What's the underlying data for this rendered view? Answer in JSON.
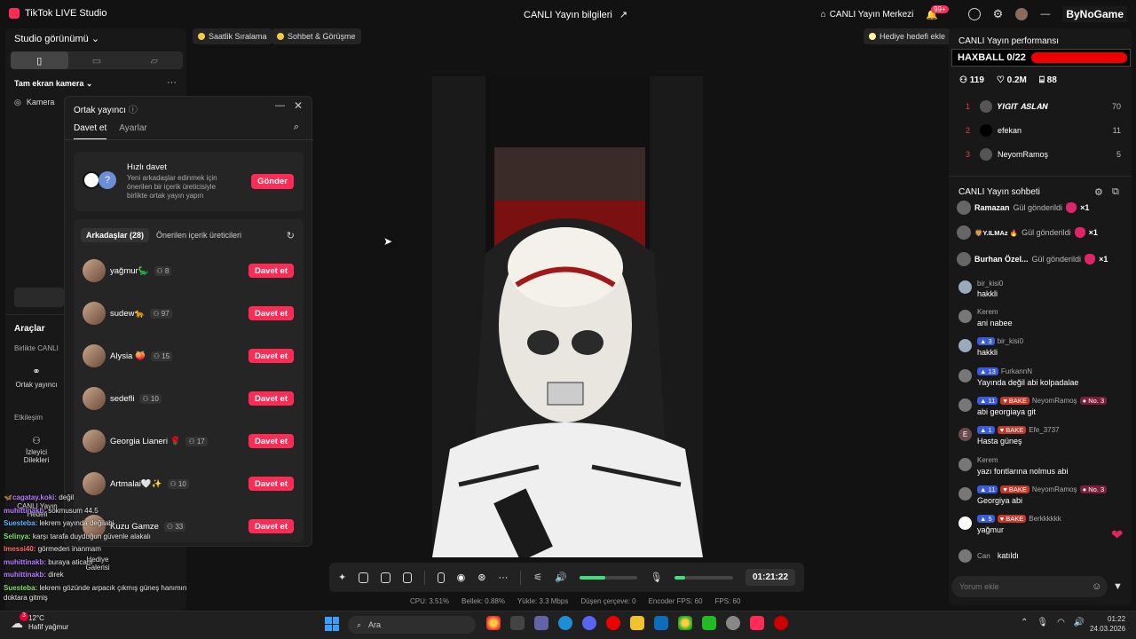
{
  "app": {
    "title": "TikTok LIVE Studio",
    "center_title": "CANLI Yayın bilgileri",
    "live_center": "CANLI Yayın Merkezi",
    "notif_badge": "99+",
    "brand_overlay": "ByNoGame"
  },
  "left": {
    "studio_view": "Studio görünümü",
    "fullscreen_cam": "Tam ekran kamera",
    "camera": "Kamera",
    "tools": "Araçlar",
    "together": "Birlikte CANLI",
    "cohost": "Ortak yayıncı",
    "interaction": "Etkileşim",
    "viewer_requests": "İzleyici Dilekleri",
    "live_goal": "CANLI Yayın Hedefi",
    "gift_gallery": "Hediye Galerisi"
  },
  "chips": {
    "hourly": "Saatlik Sıralama",
    "chat_meet": "Sohbet & Görüşme",
    "gift_goal": "Hediye hedefi ekle"
  },
  "modal": {
    "title": "Ortak yayıncı",
    "tab_invite": "Davet et",
    "tab_settings": "Ayarlar",
    "quick_title": "Hızlı davet",
    "quick_desc": "Yeni arkadaşlar edinmek için önerilen bir içerik üreticisiyle birlikte ortak yayın yapın",
    "send": "Gönder",
    "friends_tab": "Arkadaşlar (28)",
    "suggested_tab": "Önerilen içerik üreticileri",
    "invite": "Davet et",
    "friends": [
      {
        "name": "yağmur🦕",
        "count": "8"
      },
      {
        "name": "sudew🐆",
        "count": "97"
      },
      {
        "name": "Alysia 🍑",
        "count": "15"
      },
      {
        "name": "sedefli",
        "count": "10"
      },
      {
        "name": "Georgia Lianeri 🌹",
        "count": "17"
      },
      {
        "name": "Artmalai🤍✨",
        "count": "10"
      },
      {
        "name": "Kuzu Gamze",
        "count": "33"
      }
    ]
  },
  "right": {
    "perf_title": "CANLI Yayın performansı",
    "haxball": "HAXBALL 0/22",
    "viewers": "119",
    "likes": "0.2M",
    "gifts": "88",
    "ranking": [
      {
        "rank": "1",
        "name": "𝒀𝑰𝑮𝑰𝑻 𝑨𝑺𝑳𝑨𝑵",
        "score": "70"
      },
      {
        "rank": "2",
        "name": "efekan",
        "score": "11"
      },
      {
        "rank": "3",
        "name": "NeyomRamoş",
        "score": "5"
      }
    ],
    "chat_title": "CANLI Yayın sohbeti",
    "gifts_list": [
      {
        "name": "Ramazan",
        "text": "Gül gönderildi",
        "mult": "×1"
      },
      {
        "name": "🦁Y.ILMAz 🔥",
        "text": "Gül gönderildi",
        "mult": "×1"
      },
      {
        "name": "Burhan Özel...",
        "text": "Gül gönderildi",
        "mult": "×1"
      }
    ],
    "messages": [
      {
        "user": "bir_kisi0",
        "text": "hakkli",
        "level": "",
        "fan": "",
        "rank": ""
      },
      {
        "user": "Kerem",
        "text": "ani nabee",
        "level": "",
        "fan": "",
        "rank": ""
      },
      {
        "user": "bir_kisi0",
        "text": "hakkli",
        "level": "3",
        "fan": "",
        "rank": ""
      },
      {
        "user": "FurkannN",
        "text": "Yayında değil abi kolpadalae",
        "level": "13",
        "fan": "",
        "rank": ""
      },
      {
        "user": "NeyomRamoş",
        "text": "abi georgiaya git",
        "level": "11",
        "fan": "BAKE",
        "rank": "No. 3"
      },
      {
        "user": "Efe_3737",
        "text": "Hasta güneş",
        "level": "1",
        "fan": "BAKE",
        "rank": ""
      },
      {
        "user": "Kerem",
        "text": "yazı fontlarına nolmus abi",
        "level": "",
        "fan": "",
        "rank": ""
      },
      {
        "user": "NeyomRamoş",
        "text": "Georgiya abi",
        "level": "11",
        "fan": "BAKE",
        "rank": "No. 3"
      },
      {
        "user": "Berkkkkkk",
        "text": "yağmur",
        "level": "5",
        "fan": "BAKE",
        "rank": ""
      },
      {
        "user": "Can",
        "text": "katıldı",
        "level": "",
        "fan": "",
        "rank": ""
      }
    ],
    "comment_placeholder": "Yorum ekle"
  },
  "controls": {
    "timer": "01:21:22"
  },
  "status": {
    "cpu": "CPU:  3.51%",
    "mem": "Bellek:  0.88%",
    "upload": "Yükle:  3.3 Mbps",
    "drop": "Düşen çerçeve:  0",
    "enc_fps": "Encoder FPS:  60",
    "fps": "FPS:  60"
  },
  "overlay_chat": [
    {
      "user": "🦋cagatay.koki:",
      "text": "değil",
      "color": "#b77bff"
    },
    {
      "user": "muhittinakb:",
      "text": "sokmusum 44.5",
      "color": "#b77bff"
    },
    {
      "user": "Suesteba:",
      "text": "lekrem yayında değilabi",
      "color": "#5fb4ff"
    },
    {
      "user": "Selinya:",
      "text": "karşı tarafa duyduğun güvenle alakalı",
      "color": "#7ee36a"
    },
    {
      "user": "lmessi40:",
      "text": "görmeden inanmam",
      "color": "#ff6b6b"
    },
    {
      "user": "muhittinakb:",
      "text": "buraya aticam",
      "color": "#b77bff"
    },
    {
      "user": "muhittinakb:",
      "text": "direk",
      "color": "#b77bff"
    },
    {
      "user": "Suesteba:",
      "text": "lekrem gözünde arpacık çıkmış güneş hanımın",
      "color": "#7ee36a"
    },
    {
      "user": "",
      "text": "doktara gitmiş",
      "color": "#fff"
    }
  ],
  "taskbar": {
    "temp": "12°C",
    "weather": "Hafif yağmur",
    "search": "Ara",
    "time": "01:22",
    "date": "24.03.2026",
    "weather_badge": "3"
  }
}
